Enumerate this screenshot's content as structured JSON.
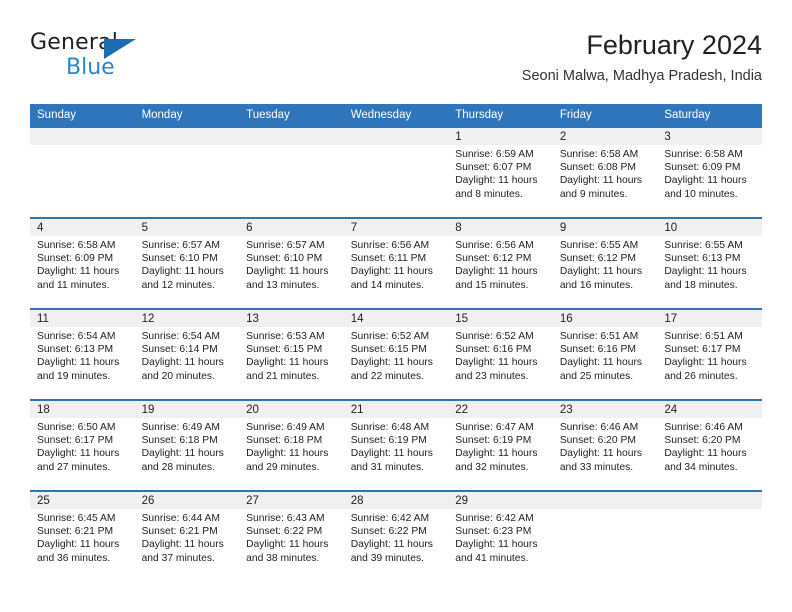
{
  "brand": {
    "word_top": "General",
    "word_bottom": "Blue",
    "accent_dark": "#1b6cb5",
    "accent_light": "#2b86d0"
  },
  "header": {
    "title": "February 2024",
    "subtitle": "Seoni Malwa, Madhya Pradesh, India"
  },
  "theme": {
    "header_blue": "#2e75bb",
    "day_strip_gray": "#f0f0f0",
    "text": "#222222"
  },
  "calendar": {
    "weekday_headers": [
      "Sunday",
      "Monday",
      "Tuesday",
      "Wednesday",
      "Thursday",
      "Friday",
      "Saturday"
    ],
    "labels": {
      "sunrise": "Sunrise:",
      "sunset": "Sunset:",
      "daylight": "Daylight:"
    },
    "weeks": [
      [
        {
          "day": "",
          "empty": true
        },
        {
          "day": "",
          "empty": true
        },
        {
          "day": "",
          "empty": true
        },
        {
          "day": "",
          "empty": true
        },
        {
          "day": "1",
          "sunrise": "Sunrise: 6:59 AM",
          "sunset": "Sunset: 6:07 PM",
          "daylight_1": "Daylight: 11 hours",
          "daylight_2": "and 8 minutes."
        },
        {
          "day": "2",
          "sunrise": "Sunrise: 6:58 AM",
          "sunset": "Sunset: 6:08 PM",
          "daylight_1": "Daylight: 11 hours",
          "daylight_2": "and 9 minutes."
        },
        {
          "day": "3",
          "sunrise": "Sunrise: 6:58 AM",
          "sunset": "Sunset: 6:09 PM",
          "daylight_1": "Daylight: 11 hours",
          "daylight_2": "and 10 minutes."
        }
      ],
      [
        {
          "day": "4",
          "sunrise": "Sunrise: 6:58 AM",
          "sunset": "Sunset: 6:09 PM",
          "daylight_1": "Daylight: 11 hours",
          "daylight_2": "and 11 minutes."
        },
        {
          "day": "5",
          "sunrise": "Sunrise: 6:57 AM",
          "sunset": "Sunset: 6:10 PM",
          "daylight_1": "Daylight: 11 hours",
          "daylight_2": "and 12 minutes."
        },
        {
          "day": "6",
          "sunrise": "Sunrise: 6:57 AM",
          "sunset": "Sunset: 6:10 PM",
          "daylight_1": "Daylight: 11 hours",
          "daylight_2": "and 13 minutes."
        },
        {
          "day": "7",
          "sunrise": "Sunrise: 6:56 AM",
          "sunset": "Sunset: 6:11 PM",
          "daylight_1": "Daylight: 11 hours",
          "daylight_2": "and 14 minutes."
        },
        {
          "day": "8",
          "sunrise": "Sunrise: 6:56 AM",
          "sunset": "Sunset: 6:12 PM",
          "daylight_1": "Daylight: 11 hours",
          "daylight_2": "and 15 minutes."
        },
        {
          "day": "9",
          "sunrise": "Sunrise: 6:55 AM",
          "sunset": "Sunset: 6:12 PM",
          "daylight_1": "Daylight: 11 hours",
          "daylight_2": "and 16 minutes."
        },
        {
          "day": "10",
          "sunrise": "Sunrise: 6:55 AM",
          "sunset": "Sunset: 6:13 PM",
          "daylight_1": "Daylight: 11 hours",
          "daylight_2": "and 18 minutes."
        }
      ],
      [
        {
          "day": "11",
          "sunrise": "Sunrise: 6:54 AM",
          "sunset": "Sunset: 6:13 PM",
          "daylight_1": "Daylight: 11 hours",
          "daylight_2": "and 19 minutes."
        },
        {
          "day": "12",
          "sunrise": "Sunrise: 6:54 AM",
          "sunset": "Sunset: 6:14 PM",
          "daylight_1": "Daylight: 11 hours",
          "daylight_2": "and 20 minutes."
        },
        {
          "day": "13",
          "sunrise": "Sunrise: 6:53 AM",
          "sunset": "Sunset: 6:15 PM",
          "daylight_1": "Daylight: 11 hours",
          "daylight_2": "and 21 minutes."
        },
        {
          "day": "14",
          "sunrise": "Sunrise: 6:52 AM",
          "sunset": "Sunset: 6:15 PM",
          "daylight_1": "Daylight: 11 hours",
          "daylight_2": "and 22 minutes."
        },
        {
          "day": "15",
          "sunrise": "Sunrise: 6:52 AM",
          "sunset": "Sunset: 6:16 PM",
          "daylight_1": "Daylight: 11 hours",
          "daylight_2": "and 23 minutes."
        },
        {
          "day": "16",
          "sunrise": "Sunrise: 6:51 AM",
          "sunset": "Sunset: 6:16 PM",
          "daylight_1": "Daylight: 11 hours",
          "daylight_2": "and 25 minutes."
        },
        {
          "day": "17",
          "sunrise": "Sunrise: 6:51 AM",
          "sunset": "Sunset: 6:17 PM",
          "daylight_1": "Daylight: 11 hours",
          "daylight_2": "and 26 minutes."
        }
      ],
      [
        {
          "day": "18",
          "sunrise": "Sunrise: 6:50 AM",
          "sunset": "Sunset: 6:17 PM",
          "daylight_1": "Daylight: 11 hours",
          "daylight_2": "and 27 minutes."
        },
        {
          "day": "19",
          "sunrise": "Sunrise: 6:49 AM",
          "sunset": "Sunset: 6:18 PM",
          "daylight_1": "Daylight: 11 hours",
          "daylight_2": "and 28 minutes."
        },
        {
          "day": "20",
          "sunrise": "Sunrise: 6:49 AM",
          "sunset": "Sunset: 6:18 PM",
          "daylight_1": "Daylight: 11 hours",
          "daylight_2": "and 29 minutes."
        },
        {
          "day": "21",
          "sunrise": "Sunrise: 6:48 AM",
          "sunset": "Sunset: 6:19 PM",
          "daylight_1": "Daylight: 11 hours",
          "daylight_2": "and 31 minutes."
        },
        {
          "day": "22",
          "sunrise": "Sunrise: 6:47 AM",
          "sunset": "Sunset: 6:19 PM",
          "daylight_1": "Daylight: 11 hours",
          "daylight_2": "and 32 minutes."
        },
        {
          "day": "23",
          "sunrise": "Sunrise: 6:46 AM",
          "sunset": "Sunset: 6:20 PM",
          "daylight_1": "Daylight: 11 hours",
          "daylight_2": "and 33 minutes."
        },
        {
          "day": "24",
          "sunrise": "Sunrise: 6:46 AM",
          "sunset": "Sunset: 6:20 PM",
          "daylight_1": "Daylight: 11 hours",
          "daylight_2": "and 34 minutes."
        }
      ],
      [
        {
          "day": "25",
          "sunrise": "Sunrise: 6:45 AM",
          "sunset": "Sunset: 6:21 PM",
          "daylight_1": "Daylight: 11 hours",
          "daylight_2": "and 36 minutes."
        },
        {
          "day": "26",
          "sunrise": "Sunrise: 6:44 AM",
          "sunset": "Sunset: 6:21 PM",
          "daylight_1": "Daylight: 11 hours",
          "daylight_2": "and 37 minutes."
        },
        {
          "day": "27",
          "sunrise": "Sunrise: 6:43 AM",
          "sunset": "Sunset: 6:22 PM",
          "daylight_1": "Daylight: 11 hours",
          "daylight_2": "and 38 minutes."
        },
        {
          "day": "28",
          "sunrise": "Sunrise: 6:42 AM",
          "sunset": "Sunset: 6:22 PM",
          "daylight_1": "Daylight: 11 hours",
          "daylight_2": "and 39 minutes."
        },
        {
          "day": "29",
          "sunrise": "Sunrise: 6:42 AM",
          "sunset": "Sunset: 6:23 PM",
          "daylight_1": "Daylight: 11 hours",
          "daylight_2": "and 41 minutes."
        },
        {
          "day": "",
          "empty": true
        },
        {
          "day": "",
          "empty": true
        }
      ]
    ]
  }
}
